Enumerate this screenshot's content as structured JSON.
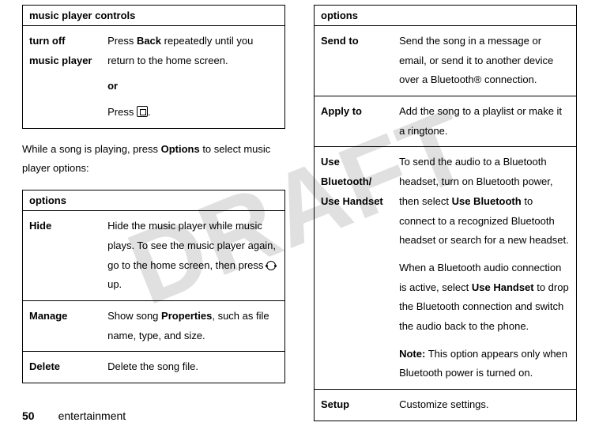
{
  "watermark": "DRAFT",
  "left": {
    "table1": {
      "header": "music player controls",
      "row": {
        "key": "turn off music player",
        "desc_pre": "Press ",
        "back": "Back",
        "desc_after_back": " repeatedly until you return to the home screen.",
        "or": "or",
        "press2_pre": "Press ",
        "press2_post": "."
      }
    },
    "paragraph_pre": "While a song is playing, press ",
    "paragraph_options": "Options",
    "paragraph_post": " to select music player options:",
    "table2": {
      "header": "options",
      "rows": [
        {
          "key": "Hide",
          "text_pre": "Hide the music player while music plays. To see the music player again, go to the home screen, then press ",
          "text_post": " up."
        },
        {
          "key": "Manage",
          "text_pre": "Show song ",
          "properties": "Properties",
          "text_post": ", such as file name, type, and size."
        },
        {
          "key": "Delete",
          "text": "Delete the song file."
        }
      ]
    }
  },
  "right": {
    "header": "options",
    "rows": {
      "sendto": {
        "key": "Send to",
        "text": "Send the song in a message or email, or send it to another device over a Bluetooth® connection."
      },
      "applyto": {
        "key": "Apply to",
        "text": "Add the song to a playlist or make it a ringtone."
      },
      "usebt": {
        "key1": "Use Bluetooth/",
        "key2": "Use Handset",
        "p1a": "To send the audio to a Bluetooth headset, turn on Bluetooth power, then select ",
        "p1b_bold": "Use Bluetooth",
        "p1c": " to connect to a recognized Bluetooth headset or search for a new headset.",
        "p2a": "When a Bluetooth audio connection is active, select ",
        "p2b_bold": "Use Handset",
        "p2c": " to drop the Bluetooth connection and switch the audio back to the phone.",
        "note_label": "Note:",
        "note_text": " This option appears only when Bluetooth power is turned on."
      },
      "setup": {
        "key": "Setup",
        "text": "Customize settings."
      }
    }
  },
  "footer": {
    "page": "50",
    "section": "entertainment"
  }
}
